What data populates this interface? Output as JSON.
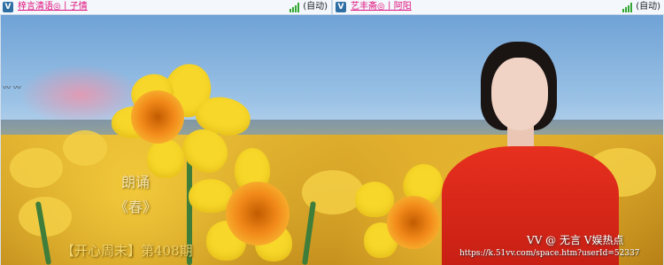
{
  "topbar": {
    "left": {
      "logo_icon": "v-logo-icon",
      "logo_glyph": "V",
      "title": "梓言清语◎丨子情",
      "signal_icon": "signal-bars-icon",
      "auto_label": "(自动)"
    },
    "right": {
      "logo_icon": "v-logo-icon",
      "logo_glyph": "V",
      "title": "艺丰斋◎丨阿阳",
      "signal_icon": "signal-bars-icon",
      "auto_label": "(自动)"
    }
  },
  "video": {
    "line_read": "朗诵",
    "line_spring": "《春》",
    "episode": "【开心周末】第408期",
    "watermark": "VV @ 无言    V娱热点",
    "url": "https://k.51vv.com/space.htm?userId=52337",
    "birds": "〰 〰"
  },
  "colors": {
    "title_link": "#e0117a",
    "signal": "#35a832",
    "dress": "#d8261a"
  }
}
